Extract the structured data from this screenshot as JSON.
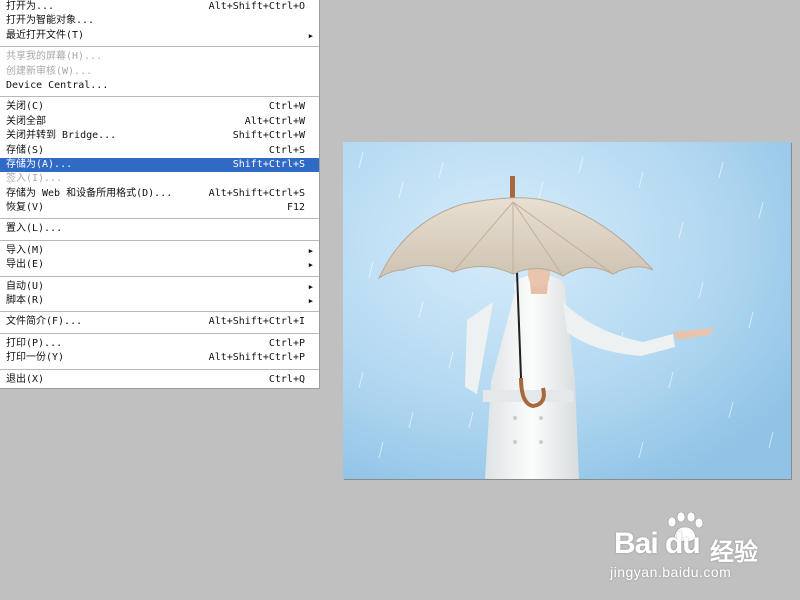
{
  "menu": {
    "items": [
      {
        "label": "打开为...",
        "shortcut": "Alt+Shift+Ctrl+O",
        "state": "normal"
      },
      {
        "label": "打开为智能对象...",
        "shortcut": "",
        "state": "normal"
      },
      {
        "label": "最近打开文件(T)",
        "shortcut": "",
        "state": "normal",
        "submenu": true
      },
      {
        "separator": true
      },
      {
        "label": "共享我的屏幕(H)...",
        "shortcut": "",
        "state": "disabled"
      },
      {
        "label": "创建新审核(W)...",
        "shortcut": "",
        "state": "disabled"
      },
      {
        "label": "Device Central...",
        "shortcut": "",
        "state": "normal"
      },
      {
        "separator": true
      },
      {
        "label": "关闭(C)",
        "shortcut": "Ctrl+W",
        "state": "normal"
      },
      {
        "label": "关闭全部",
        "shortcut": "Alt+Ctrl+W",
        "state": "normal"
      },
      {
        "label": "关闭并转到 Bridge...",
        "shortcut": "Shift+Ctrl+W",
        "state": "normal"
      },
      {
        "label": "存储(S)",
        "shortcut": "Ctrl+S",
        "state": "normal"
      },
      {
        "label": "存储为(A)...",
        "shortcut": "Shift+Ctrl+S",
        "state": "highlighted"
      },
      {
        "label": "签入(I)...",
        "shortcut": "",
        "state": "disabled"
      },
      {
        "label": "存储为 Web 和设备所用格式(D)...",
        "shortcut": "Alt+Shift+Ctrl+S",
        "state": "normal"
      },
      {
        "label": "恢复(V)",
        "shortcut": "F12",
        "state": "normal"
      },
      {
        "separator": true
      },
      {
        "label": "置入(L)...",
        "shortcut": "",
        "state": "normal"
      },
      {
        "separator": true
      },
      {
        "label": "导入(M)",
        "shortcut": "",
        "state": "normal",
        "submenu": true
      },
      {
        "label": "导出(E)",
        "shortcut": "",
        "state": "normal",
        "submenu": true
      },
      {
        "separator": true
      },
      {
        "label": "自动(U)",
        "shortcut": "",
        "state": "normal",
        "submenu": true
      },
      {
        "label": "脚本(R)",
        "shortcut": "",
        "state": "normal",
        "submenu": true
      },
      {
        "separator": true
      },
      {
        "label": "文件简介(F)...",
        "shortcut": "Alt+Shift+Ctrl+I",
        "state": "normal"
      },
      {
        "separator": true
      },
      {
        "label": "打印(P)...",
        "shortcut": "Ctrl+P",
        "state": "normal"
      },
      {
        "label": "打印一份(Y)",
        "shortcut": "Alt+Shift+Ctrl+P",
        "state": "normal"
      },
      {
        "separator": true
      },
      {
        "label": "退出(X)",
        "shortcut": "Ctrl+Q",
        "state": "normal"
      }
    ],
    "submenu_icon": "triangle-right-icon"
  },
  "document": {
    "image_subject": "woman-with-umbrella-in-rain"
  },
  "watermark": {
    "brand_word": "Bai du",
    "brand_cn": "经验",
    "url": "jingyan.baidu.com",
    "icon": "paw-icon"
  },
  "colors": {
    "workspace": "#c0c0c0",
    "menu_bg": "#ffffff",
    "highlight": "#316ac5",
    "disabled_text": "#a8a8a8",
    "sky_blue": "#a9d2ee"
  }
}
